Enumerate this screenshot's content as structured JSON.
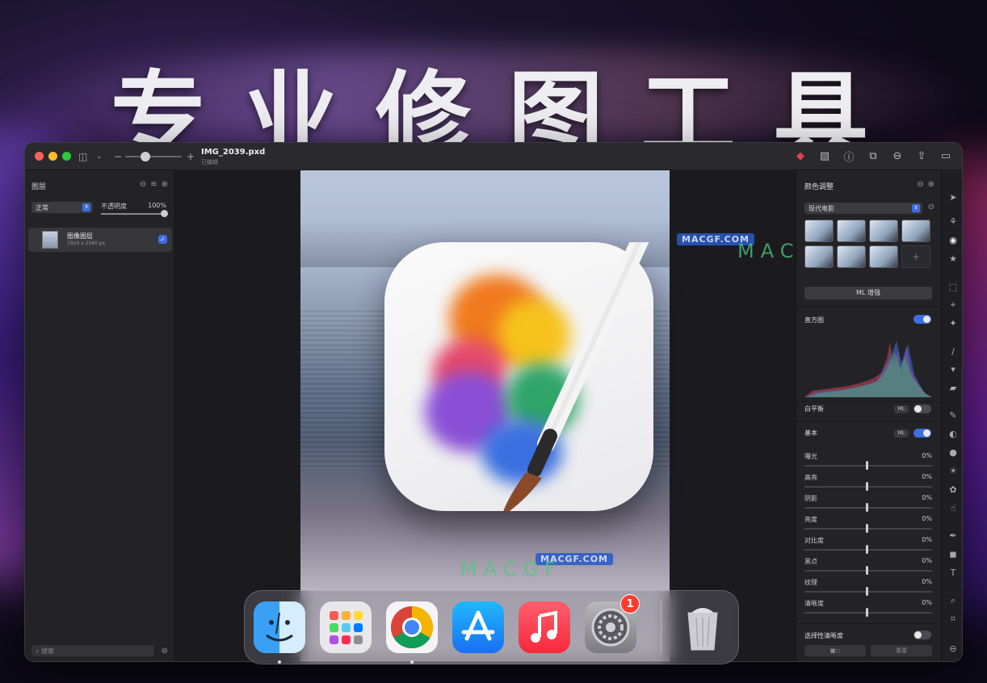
{
  "headline": "专业修图工具",
  "window": {
    "doc_title": "IMG_2039.pxd",
    "doc_status": "已编辑",
    "zoom_minus": "−",
    "zoom_plus": "+"
  },
  "layers_panel": {
    "title": "图层",
    "blend_mode": "正常",
    "opacity_label": "不透明度",
    "opacity_value": "100%",
    "layer": {
      "name": "图像图层",
      "size": "1920 x 2560 px"
    },
    "search_placeholder": "搜索"
  },
  "adjust_panel": {
    "title": "颜色调整",
    "preset": "现代电影",
    "thumb_add": "+",
    "ml_enhance": "ML 增强",
    "histogram_label": "直方图",
    "white_balance_label": "白平衡",
    "basic_label": "基本",
    "ml_pill": "ML",
    "sliders": [
      {
        "label": "曝光",
        "value": "0%"
      },
      {
        "label": "高亮",
        "value": "0%"
      },
      {
        "label": "阴影",
        "value": "0%"
      },
      {
        "label": "亮度",
        "value": "0%"
      },
      {
        "label": "对比度",
        "value": "0%"
      },
      {
        "label": "黑点",
        "value": "0%"
      },
      {
        "label": "纹理",
        "value": "0%"
      },
      {
        "label": "清晰度",
        "value": "0%"
      }
    ],
    "selective_label": "选择性清晰度",
    "btn_left": "■◻",
    "btn_reset": "重置"
  },
  "watermarks": {
    "badge": "MACGF.COM",
    "big": "MACGF",
    "small": "MACGF"
  },
  "dock": {
    "settings_badge": "1"
  },
  "colors": {
    "accent": "#3d6de0",
    "panel": "#232327",
    "badge": "#ff3b30"
  }
}
